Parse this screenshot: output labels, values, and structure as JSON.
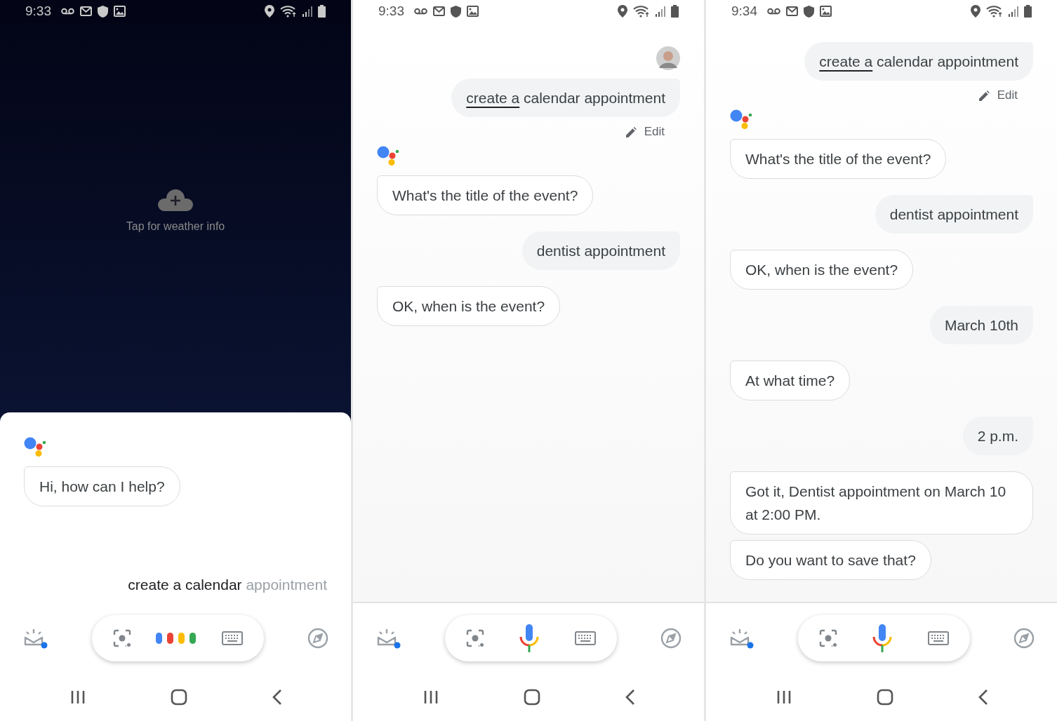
{
  "screens": [
    {
      "time": "9:33",
      "kind": "dark",
      "weather": {
        "label": "Tap for weather info"
      },
      "messages": [
        {
          "kind": "assistant",
          "text": "Hi, how can I help?"
        }
      ],
      "query": {
        "final": "create a calendar",
        "pending": "appointment"
      },
      "input_bar": {
        "kind": "listening"
      }
    },
    {
      "time": "9:33",
      "kind": "light",
      "messages": [
        {
          "kind": "user",
          "avatar": true,
          "underlined": "create a",
          "text": "calendar appointment",
          "edit_label": "Edit"
        },
        {
          "kind": "assistant",
          "text": "What's the title of the event?"
        },
        {
          "kind": "user",
          "text": "dentist appointment"
        },
        {
          "kind": "assistant",
          "text": "OK, when is the event?"
        }
      ],
      "input_bar": {
        "kind": "idle"
      }
    },
    {
      "time": "9:34",
      "kind": "light",
      "messages": [
        {
          "kind": "user",
          "underlined": "create a",
          "text": "calendar appointment",
          "edit_label": "Edit"
        },
        {
          "kind": "assistant",
          "text": "What's the title of the event?"
        },
        {
          "kind": "user",
          "text": "dentist appointment"
        },
        {
          "kind": "assistant",
          "text": "OK, when is the event?"
        },
        {
          "kind": "user",
          "text": "March 10th"
        },
        {
          "kind": "assistant",
          "text": "At what time?"
        },
        {
          "kind": "user",
          "text": "2 p.m."
        },
        {
          "kind": "assistant",
          "text": "Got it, Dentist appointment on March 10 at 2:00 PM."
        },
        {
          "kind": "assistant",
          "text": "Do you want to save that?"
        }
      ],
      "input_bar": {
        "kind": "idle"
      }
    }
  ]
}
